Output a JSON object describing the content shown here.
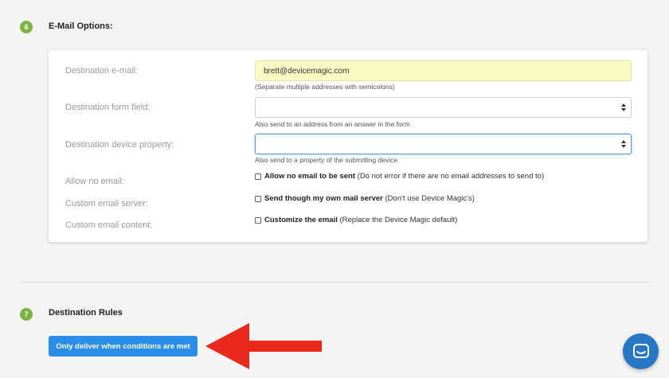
{
  "email_section": {
    "step": "6",
    "title": "E-Mail Options:",
    "destination_email": {
      "label": "Destination e-mail:",
      "value": "brett@devicemagic.com",
      "help": "(Separate multiple addresses with semicolons)"
    },
    "destination_form_field": {
      "label": "Destination form field:",
      "value": "",
      "help": "Also send to an address from an answer in the form"
    },
    "destination_device_property": {
      "label": "Destination device property:",
      "value": "",
      "help": "Also send to a property of the submitting device"
    },
    "allow_no_email": {
      "label": "Allow no email:",
      "checkbox_bold": "Allow no email to be sent",
      "checkbox_note": " (Do not error if there are no email addresses to send to)",
      "checked": false
    },
    "custom_email_server": {
      "label": "Custom email server:",
      "checkbox_bold": "Send though my own mail server",
      "checkbox_note": " (Don't use Device Magic's)",
      "checked": false
    },
    "custom_email_content": {
      "label": "Custom email content:",
      "checkbox_bold": "Customize the email",
      "checkbox_note": " (Replace the Device Magic default)",
      "checked": false
    }
  },
  "rules_section": {
    "step": "7",
    "title": "Destination Rules",
    "button_label": "Only deliver when conditions are met"
  },
  "annotation": {
    "arrow_color": "#e8291c"
  },
  "chat_widget": {
    "icon": "chat-icon",
    "color": "#2877c4"
  },
  "colors": {
    "step_badge": "#7cb342",
    "primary_button": "#2a8ee8",
    "highlight_field": "#fafcc6"
  }
}
